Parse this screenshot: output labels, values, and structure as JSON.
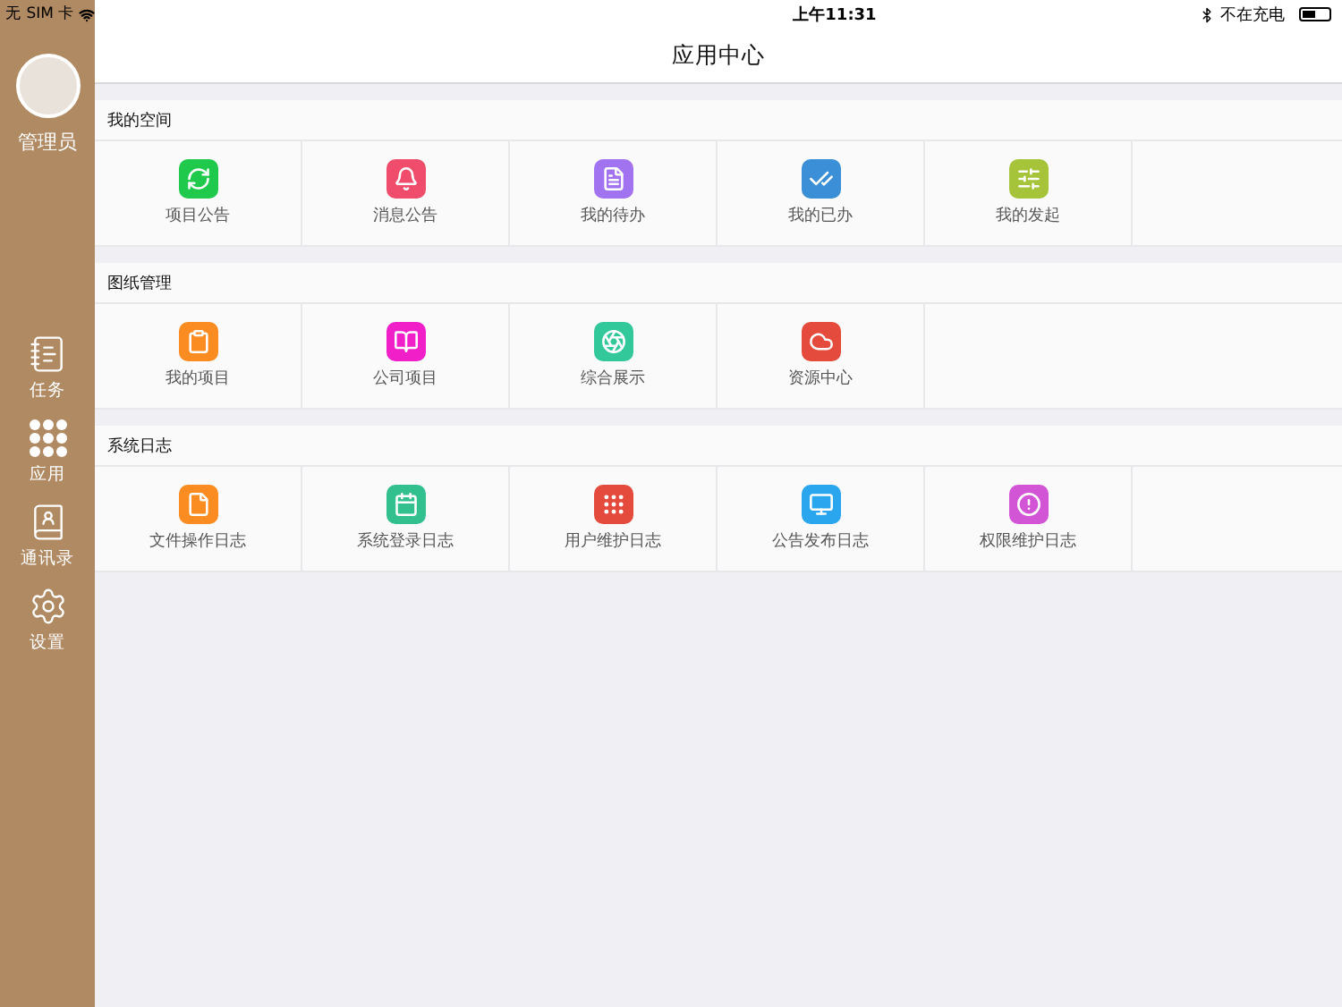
{
  "status_bar": {
    "carrier": "无 SIM 卡",
    "time": "上午11:31",
    "charging": "不在充电"
  },
  "sidebar": {
    "user": "管理员",
    "items": [
      {
        "label": "任务",
        "kind": "tasks"
      },
      {
        "label": "应用",
        "kind": "apps"
      },
      {
        "label": "通讯录",
        "kind": "contacts"
      },
      {
        "label": "设置",
        "kind": "settings"
      }
    ]
  },
  "header": {
    "title": "应用中心"
  },
  "groups": [
    {
      "title": "我的空间",
      "items": [
        {
          "label": "项目公告",
          "kind": "refresh",
          "color": "#1ec94c"
        },
        {
          "label": "消息公告",
          "kind": "bell",
          "color": "#ef4d6b"
        },
        {
          "label": "我的待办",
          "kind": "list",
          "color": "#a173f0"
        },
        {
          "label": "我的已办",
          "kind": "check",
          "color": "#3b8fd6"
        },
        {
          "label": "我的发起",
          "kind": "sliders",
          "color": "#a5c43a"
        }
      ]
    },
    {
      "title": "图纸管理",
      "items": [
        {
          "label": "我的项目",
          "kind": "clipboard",
          "color": "#fa8c22"
        },
        {
          "label": "公司项目",
          "kind": "book",
          "color": "#f01fc8"
        },
        {
          "label": "综合展示",
          "kind": "aperture",
          "color": "#32c89a"
        },
        {
          "label": "资源中心",
          "kind": "cloud",
          "color": "#e54b3c"
        }
      ]
    },
    {
      "title": "系统日志",
      "items": [
        {
          "label": "文件操作日志",
          "kind": "file",
          "color": "#fa8c22"
        },
        {
          "label": "系统登录日志",
          "kind": "calendar",
          "color": "#32c08f"
        },
        {
          "label": "用户维护日志",
          "kind": "grid",
          "color": "#e54b3c"
        },
        {
          "label": "公告发布日志",
          "kind": "monitor",
          "color": "#2aa6ef"
        },
        {
          "label": "权限维护日志",
          "kind": "alert",
          "color": "#d255d6"
        }
      ]
    }
  ]
}
